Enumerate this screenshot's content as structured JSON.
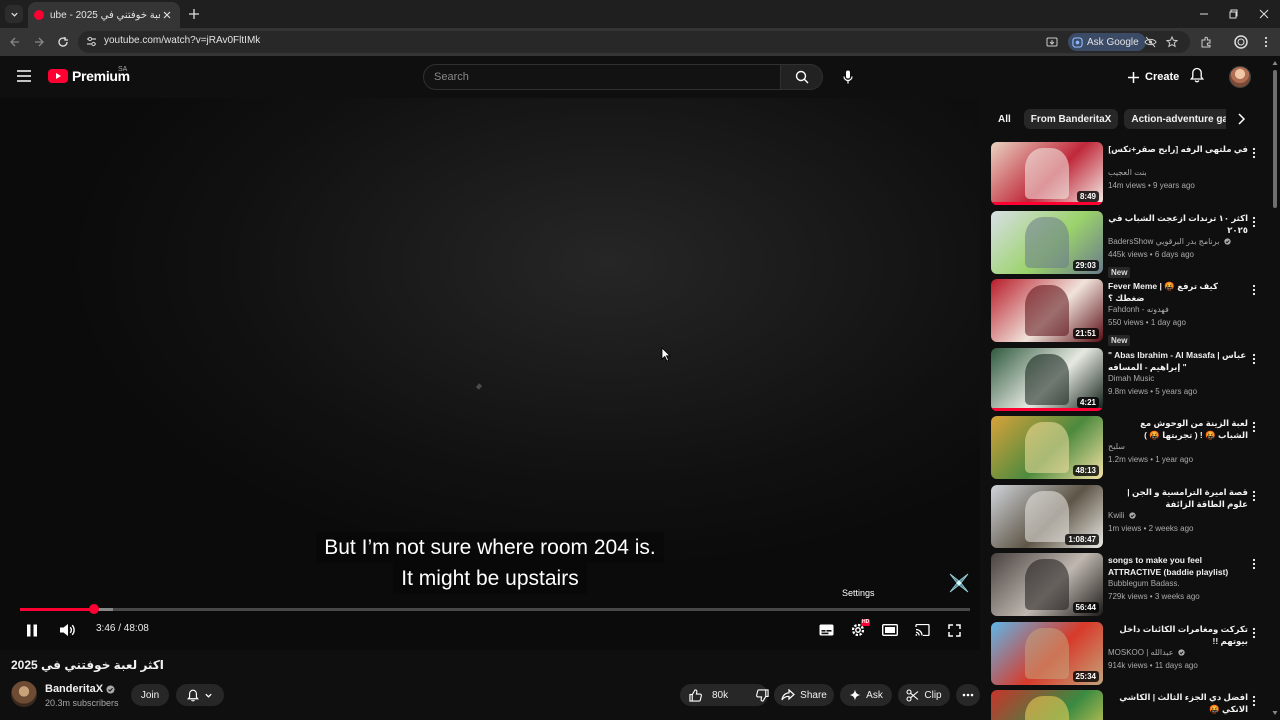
{
  "browser": {
    "tab_title": "ube - 2025 اكثر لعبة خوفتني في",
    "url": "youtube.com/watch?v=jRAv0FltIMk",
    "ask_google": "Ask Google"
  },
  "masthead": {
    "logo_text": "Premium",
    "country_code": "SA",
    "search_placeholder": "Search",
    "create_label": "Create"
  },
  "player": {
    "captions": [
      "But I’m not sure where room 204 is.",
      "It might be upstairs"
    ],
    "current_time": "3:46",
    "duration": "48:08",
    "time_display": "3:46 / 48:08",
    "progress_fraction": 0.0783,
    "settings_tooltip": "Settings",
    "settings_badge": "HD"
  },
  "video": {
    "title": "اكثر لعبة خوفتني في 2025",
    "channel": "BanderitaX",
    "subscribers": "20.3m subscribers",
    "join_label": "Join",
    "likes": "80k",
    "share_label": "Share",
    "ask_label": "Ask",
    "clip_label": "Clip"
  },
  "sidebar": {
    "chips": [
      "All",
      "From BanderitaX",
      "Action-adventure games"
    ],
    "recommendations": [
      {
        "title": "في ملتهى الرفه [رابح صقر+تكس]",
        "channel": "بنت العجيب",
        "stats": "14m views • 9 years ago",
        "duration": "8:49",
        "badge": "",
        "watched": 1.0,
        "verified": false,
        "colors": [
          "#e9d3c2",
          "#c0283a",
          "#f4f0ea"
        ]
      },
      {
        "title": "اكثر ١٠ ترندات ازعجت الشباب في ٢٠٢٥",
        "channel": "BadersShow برنامج بدر البرقويي",
        "stats": "445k views • 6 days ago",
        "duration": "29:03",
        "badge": "New",
        "watched": 0,
        "verified": true,
        "colors": [
          "#d8dfe6",
          "#9bd36b",
          "#6a7a8c"
        ]
      },
      {
        "title": "Fever Meme | 🤬 كيف ترفع ضغطك ؟",
        "channel": "Fahdonh - فهدونه",
        "stats": "550 views • 1 day ago",
        "duration": "21:51",
        "badge": "New",
        "watched": 0,
        "verified": false,
        "colors": [
          "#b81c2a",
          "#f0e3da",
          "#5a0c14"
        ]
      },
      {
        "title": "\" Abas Ibrahim - Al Masafa | عباس إبراهيم - المسافه \"",
        "channel": "Dimah Music",
        "stats": "9.8m views • 5 years ago",
        "duration": "4:21",
        "badge": "",
        "watched": 1.0,
        "verified": false,
        "colors": [
          "#2f5a3f",
          "#e6e9e1",
          "#0e1d16"
        ]
      },
      {
        "title": "لعبة الزينة من الوحوش مع الشباب 🤬 ! ( تجربتها 🤬 )",
        "channel": "سلبح",
        "stats": "1.2m views • 1 year ago",
        "duration": "48:13",
        "badge": "",
        "watched": 0,
        "verified": false,
        "colors": [
          "#d9a23a",
          "#4d8a3e",
          "#f4e2a2"
        ]
      },
      {
        "title": "قصة اميرة الترامسية و الجن | علوم الطاقة الزائفة",
        "channel": "Kwili",
        "stats": "1m views • 2 weeks ago",
        "duration": "1:08:47",
        "badge": "",
        "watched": 0,
        "verified": true,
        "colors": [
          "#cfd4da",
          "#5e5546",
          "#ecebe7"
        ]
      },
      {
        "title": "songs to make you feel ATTRACTIVE (baddie playlist)",
        "channel": "Bubblegum Badass.",
        "stats": "729k views • 3 weeks ago",
        "duration": "56:44",
        "badge": "",
        "watched": 0,
        "verified": false,
        "colors": [
          "#4a4240",
          "#bfb8b0",
          "#1d1a19"
        ]
      },
      {
        "title": "تكركت ومغامرات الكائنات داخل بيوتهم !!",
        "channel": "MOSKOO | عبدالله",
        "stats": "914k views • 11 days ago",
        "duration": "25:34",
        "badge": "",
        "watched": 0,
        "verified": true,
        "colors": [
          "#5fb6e8",
          "#d83a2a",
          "#c4a47a"
        ]
      },
      {
        "title": "افضل دي الجزء الثالث | الكاشي الانكي 🤬",
        "channel": "",
        "stats": "",
        "duration": "",
        "badge": "",
        "watched": 0,
        "verified": false,
        "colors": [
          "#c8342c",
          "#3a8a42",
          "#f2d65a"
        ]
      }
    ]
  },
  "colors": {
    "brand_red": "#ff0033",
    "background": "#0f0f0f",
    "chip_bg": "#272727"
  }
}
